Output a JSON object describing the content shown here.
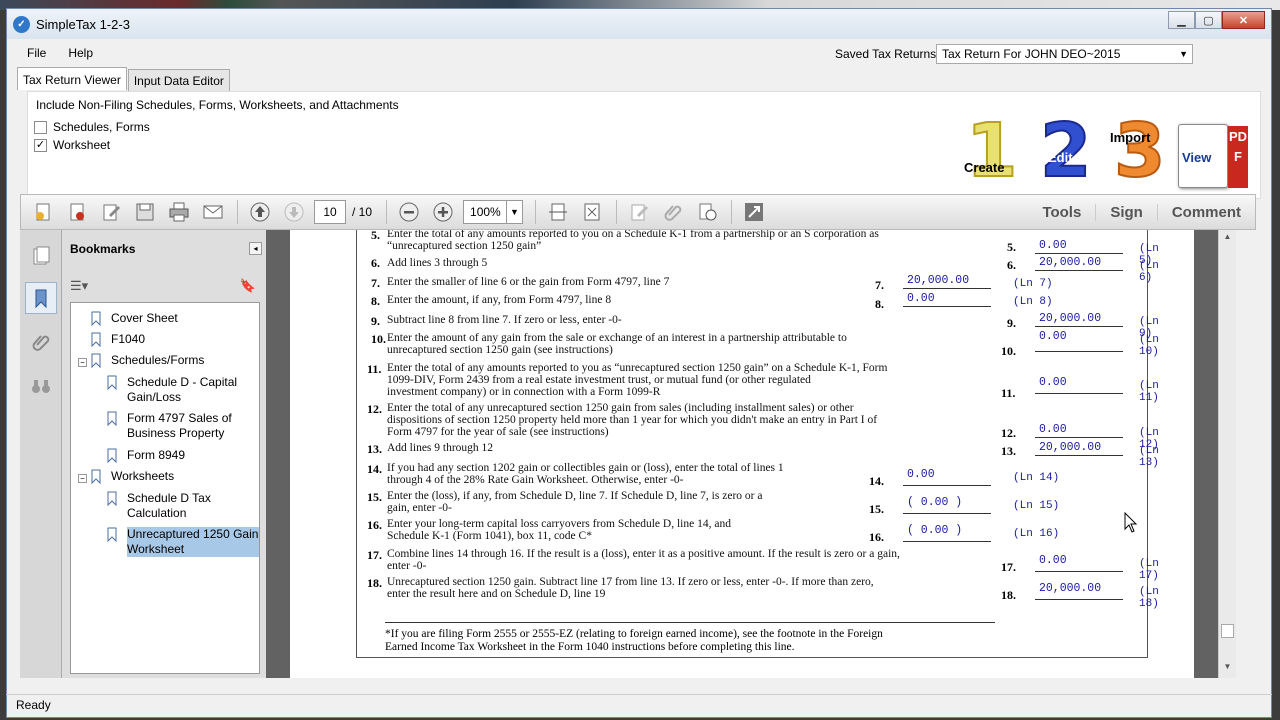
{
  "window": {
    "title": "SimpleTax 1-2-3"
  },
  "menu": [
    "File",
    "Help"
  ],
  "saved_returns": {
    "label": "Saved Tax Returns",
    "selected": "Tax Return For JOHN DEO~2015"
  },
  "tabs": [
    "Tax Return Viewer",
    "Input Data Editor"
  ],
  "options": {
    "heading": "Include Non-Filing Schedules, Forms, Worksheets, and Attachments",
    "checkboxes": [
      {
        "label": "Schedules, Forms",
        "checked": false
      },
      {
        "label": "Worksheet",
        "checked": true
      }
    ]
  },
  "big_buttons": {
    "create": {
      "num": "1",
      "label": "Create"
    },
    "edit": {
      "num": "2",
      "label": "Edit"
    },
    "import": {
      "num": "3",
      "label": "Import"
    },
    "view": {
      "label": "View",
      "pdf": "PDF"
    }
  },
  "toolbar": {
    "page": "10",
    "total": "/ 10",
    "zoom": "100%",
    "right": [
      "Tools",
      "Sign",
      "Comment"
    ]
  },
  "bookmarks": {
    "title": "Bookmarks",
    "items": [
      "Cover Sheet",
      "F1040",
      "Schedules/Forms",
      "Schedule D - Capital Gain/Loss",
      "Form 4797 Sales of Business Property",
      "Form 8949",
      "Worksheets",
      "Schedule D Tax Calculation",
      "Unrecaptured 1250 Gain Worksheet"
    ]
  },
  "worksheet": {
    "lines": [
      {
        "n": "5.",
        "text1": "Enter the total of any amounts reported to you on a Schedule K-1 from a partnership or an S corporation as",
        "text2": "“unrecaptured section 1250 gain”",
        "lbl": "5.",
        "value": "0.00",
        "ref": "(Ln 5)"
      },
      {
        "n": "6.",
        "text1": "Add lines 3 through 5",
        "lbl": "6.",
        "value": "20,000.00",
        "ref": "(Ln 6)"
      },
      {
        "n": "7.",
        "text1": "Enter the smaller of line 6 or the gain from Form 4797, line 7",
        "lbl": "7.",
        "value": "20,000.00",
        "ref": "(Ln 7)"
      },
      {
        "n": "8.",
        "text1": "Enter the amount, if any, from Form 4797, line 8",
        "lbl": "8.",
        "value": "0.00",
        "ref": "(Ln 8)"
      },
      {
        "n": "9.",
        "text1": "Subtract line 8 from line 7. If zero or less, enter -0-",
        "lbl": "9.",
        "value": "20,000.00",
        "ref": "(Ln 9)"
      },
      {
        "n": "10.",
        "text1": "Enter the amount of any gain from the sale or exchange of an interest in a partnership attributable to",
        "text2": "unrecaptured section 1250 gain (see instructions)",
        "lbl": "10.",
        "value": "0.00",
        "ref": "(Ln 10)"
      },
      {
        "n": "11.",
        "text1": "Enter the total of any amounts reported to you as “unrecaptured section 1250 gain” on a Schedule K-1, Form",
        "text2": "1099-DIV, Form 2439 from a real estate investment trust, or mutual fund (or other regulated",
        "text3": "investment company) or in connection with a Form 1099-R",
        "lbl": "11.",
        "value": "0.00",
        "ref": "(Ln 11)"
      },
      {
        "n": "12.",
        "text1": "Enter the total of any unrecaptured section 1250 gain from sales (including installment sales) or other",
        "text2": "dispositions of section 1250 property held more than 1 year for which you didn't make an entry in Part I of",
        "text3": "Form 4797 for the year of sale (see instructions)",
        "lbl": "12.",
        "value": "0.00",
        "ref": "(Ln 12)"
      },
      {
        "n": "13.",
        "text1": "Add lines 9 through 12",
        "lbl": "13.",
        "value": "20,000.00",
        "ref": "(Ln 13)"
      },
      {
        "n": "14.",
        "text1": "If you had any section 1202 gain or collectibles gain or (loss), enter the total of lines 1",
        "text2": "through 4 of the 28% Rate Gain Worksheet. Otherwise, enter -0-",
        "lbl": "14.",
        "value": "0.00",
        "ref": "(Ln 14)"
      },
      {
        "n": "15.",
        "text1": "Enter the (loss), if any, from Schedule D, line 7. If Schedule D, line 7, is zero or a",
        "text2": "gain, enter -0-",
        "lbl": "15.",
        "value": "( 0.00    )",
        "ref": "(Ln 15)"
      },
      {
        "n": "16.",
        "text1": "Enter your long-term capital loss carryovers from Schedule D, line 14, and",
        "text2": "Schedule K-1 (Form 1041), box 11, code C*",
        "lbl": "16.",
        "value": "( 0.00    )",
        "ref": "(Ln 16)"
      },
      {
        "n": "17.",
        "text1": "Combine lines 14 through 16. If the result is a (loss), enter it as a positive amount. If the result is zero or a gain,",
        "text2": "enter -0-",
        "lbl": "17.",
        "value": "0.00",
        "ref": "(Ln 17)"
      },
      {
        "n": "18.",
        "text1": "Unrecaptured section 1250 gain. Subtract line 17 from line 13. If zero or less, enter -0-. If more than zero,",
        "text2": "enter the result here and on Schedule D, line 19",
        "lbl": "18.",
        "value": "20,000.00",
        "ref": "(Ln 18)"
      }
    ],
    "footnote1": "*If you are filing Form 2555 or 2555-EZ (relating to foreign earned income), see the footnote in the Foreign",
    "footnote2": "Earned Income Tax Worksheet in the Form 1040 instructions before completing this line."
  },
  "status": "Ready"
}
